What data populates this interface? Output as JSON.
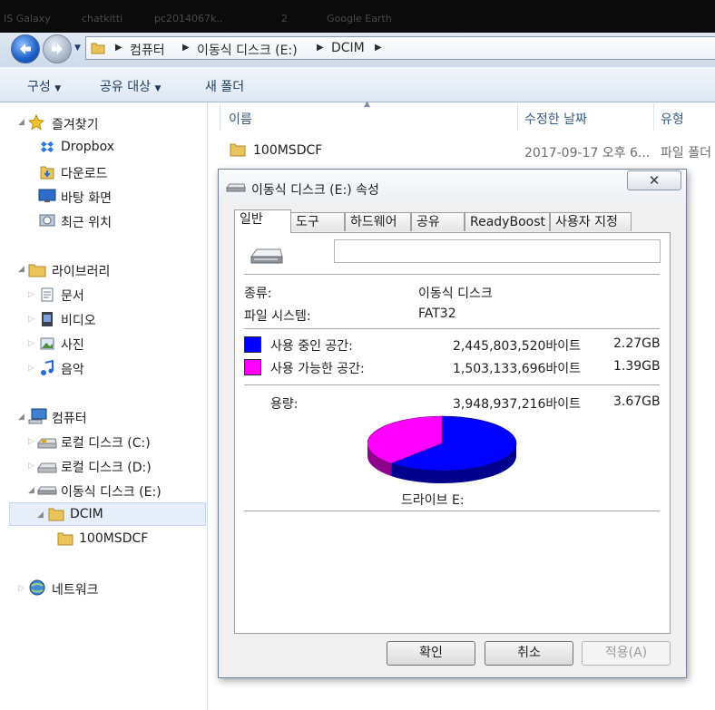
{
  "taskbar_fragments": [
    "IS Galaxy",
    "chatkitti",
    "pc2014067k..",
    "2",
    "Google Earth"
  ],
  "address_bar": {
    "crumbs": [
      "컴퓨터",
      "이동식 디스크 (E:)",
      "DCIM"
    ]
  },
  "toolbar": {
    "organize_label": "구성",
    "share_label": "공유 대상",
    "new_folder_label": "새 폴더"
  },
  "nav": {
    "favorites": "즐겨찾기",
    "fav_items": [
      "Dropbox",
      "다운로드",
      "바탕 화면",
      "최근 위치"
    ],
    "libraries": "라이브러리",
    "lib_items": [
      "문서",
      "비디오",
      "사진",
      "음악"
    ],
    "computer": "컴퓨터",
    "drives": [
      "로컬 디스크 (C:)",
      "로컬 디스크 (D:)",
      "이동식 디스크 (E:)"
    ],
    "dcim": "DCIM",
    "subfolder": "100MSDCF",
    "network": "네트워크"
  },
  "file_list": {
    "columns": [
      "이름",
      "수정한 날짜",
      "유형"
    ],
    "rows": [
      {
        "name": "100MSDCF",
        "date": "2017-09-17 오후 6...",
        "type": "파일 폴더"
      }
    ]
  },
  "dialog": {
    "title": "이동식 디스크 (E:) 속성",
    "close_symbol": "✕",
    "tabs": [
      "일반",
      "도구",
      "하드웨어",
      "공유",
      "ReadyBoost",
      "사용자 지정"
    ],
    "active_tab": "일반",
    "name_value": "",
    "type_label": "종류:",
    "type_value": "이동식 디스크",
    "fs_label": "파일 시스템:",
    "fs_value": "FAT32",
    "used_label": "사용 중인 공간:",
    "used_bytes": "2,445,803,520바이트",
    "used_size": "2.27GB",
    "free_label": "사용 가능한 공간:",
    "free_bytes": "1,503,133,696바이트",
    "free_size": "1.39GB",
    "capacity_label": "용량:",
    "capacity_bytes": "3,948,937,216바이트",
    "capacity_size": "3.67GB",
    "drive_label": "드라이브 E:",
    "used_fraction": 0.6193,
    "colors": {
      "used": "#0000ff",
      "free": "#ff00ff"
    },
    "buttons": {
      "ok": "확인",
      "cancel": "취소",
      "apply": "적용(A)"
    }
  }
}
